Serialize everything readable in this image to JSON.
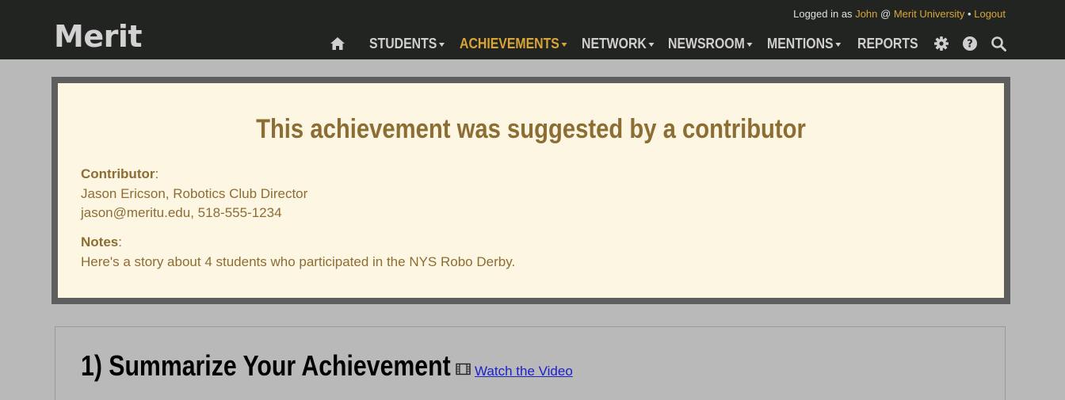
{
  "header": {
    "logo": "Merit",
    "user": {
      "prefix": "Logged in as",
      "name": "John",
      "at": "@",
      "org": "Merit University",
      "separator": "•",
      "logout": "Logout"
    },
    "nav": [
      {
        "label": "STUDENTS",
        "dropdown": true,
        "active": false
      },
      {
        "label": "ACHIEVEMENTS",
        "dropdown": true,
        "active": true
      },
      {
        "label": "NETWORK",
        "dropdown": true,
        "active": false
      },
      {
        "label": "NEWSROOM",
        "dropdown": true,
        "active": false
      },
      {
        "label": "MENTIONS",
        "dropdown": true,
        "active": false
      },
      {
        "label": "REPORTS",
        "dropdown": false,
        "active": false
      }
    ],
    "icons": [
      "home-icon",
      "gear-icon",
      "help-icon",
      "search-icon"
    ]
  },
  "notice": {
    "title": "This achievement was suggested by a contributor",
    "contributor_label": "Contributor",
    "contributor_name": "Jason Ericson, Robotics Club Director",
    "contributor_contact": "jason@meritu.edu, 518-555-1234",
    "notes_label": "Notes",
    "notes_text": "Here's a story about 4 students who participated in the NYS Robo Derby."
  },
  "section": {
    "title": "1) Summarize Your Achievement",
    "video_link": "Watch the Video"
  },
  "colors": {
    "topbar": "#222421",
    "accent": "#d9a536",
    "notice_bg": "#fdf6e3",
    "notice_text": "#8c6d34",
    "page_bg": "#b9b9b9",
    "link": "#1a22c8"
  }
}
